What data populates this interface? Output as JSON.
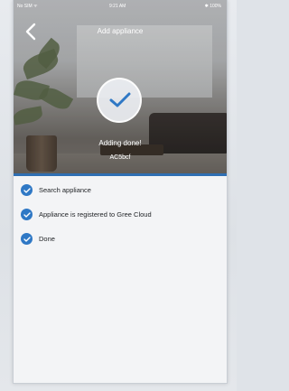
{
  "status_bar": {
    "carrier": "No SIM ᯤ",
    "time": "9:21 AM",
    "battery": "✱ 100%"
  },
  "header": {
    "title": "Add appliance",
    "back_icon": "chevron-left-icon"
  },
  "status": {
    "message": "Adding done!",
    "device_name": "AC5bcf",
    "icon": "checkmark-icon"
  },
  "steps": [
    {
      "label": "Search appliance",
      "icon": "check-circle-icon"
    },
    {
      "label": "Appliance is registered to Gree Cloud",
      "icon": "check-circle-icon"
    },
    {
      "label": "Done",
      "icon": "check-circle-icon"
    }
  ],
  "colors": {
    "accent": "#2f78c5",
    "divider": "#2f6fb3",
    "background": "#f3f4f6"
  }
}
